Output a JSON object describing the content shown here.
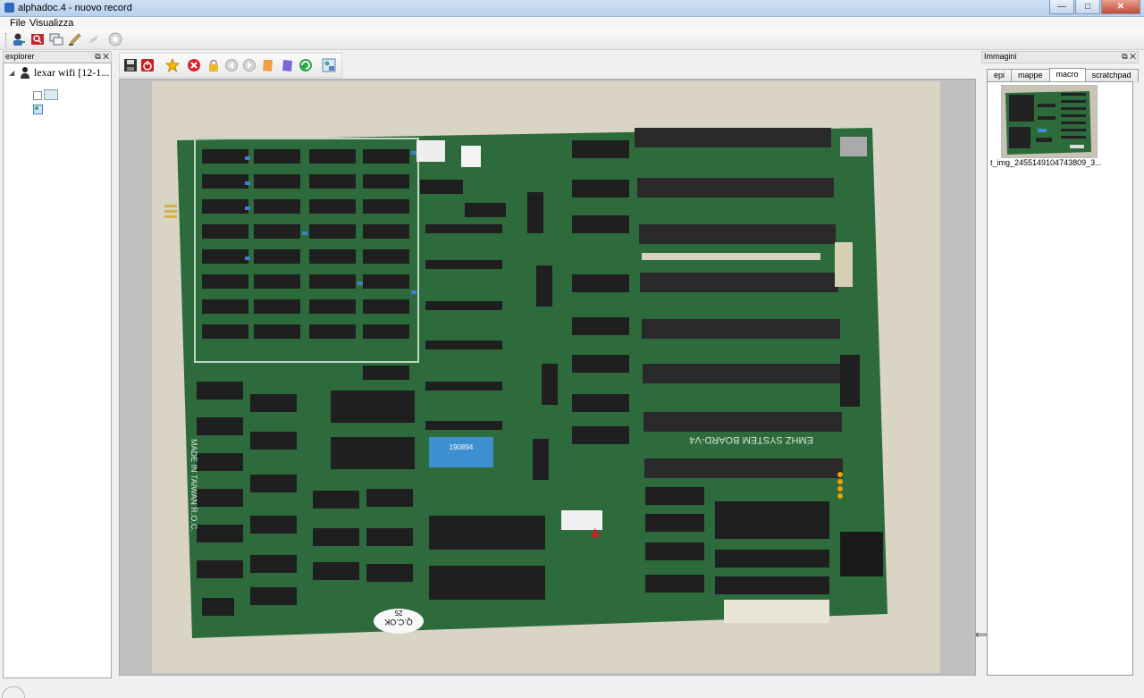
{
  "window": {
    "title": "alphadoc.4 - nuovo record",
    "btn_min": "—",
    "btn_max": "□",
    "btn_close": "✕"
  },
  "menu": {
    "items": [
      "File",
      "Visualizza"
    ]
  },
  "main_toolbar": {
    "icons": [
      "user-add-icon",
      "search-record-icon",
      "windows-icon",
      "edit-pen-icon",
      "disabled-tool-icon",
      "help-icon"
    ]
  },
  "explorer": {
    "title": "explorer",
    "float_btn": "⧉",
    "close_btn": "✕",
    "expand_arrow": "◢",
    "root_label": "lexar wifi [12-1..."
  },
  "doc_toolbar": {
    "icons": [
      "save-icon",
      "power-icon",
      "star-icon",
      "delete-icon",
      "lock-icon",
      "back-icon",
      "forward-icon",
      "note-orange-icon",
      "note-purple-icon",
      "refresh-green-icon",
      "image-settings-icon"
    ]
  },
  "images_panel": {
    "title": "Immagini",
    "float_btn": "⧉",
    "close_btn": "✕",
    "tabs": [
      "epi",
      "mappe",
      "macro",
      "scratchpad"
    ],
    "active_tab": "macro",
    "thumb_label": "t_img_2455149104743809_3..."
  },
  "board": {
    "silk_label": "EMHZ SYSTEM BOARD-V4",
    "made_in": "MADE IN TAIWAN R.O.C.",
    "qc_sticker": "Q.C.OK",
    "qc_number": "25",
    "eprom_label": "190894"
  },
  "colors": {
    "pcb": "#2d6b3c",
    "chip": "#222222",
    "slot": "#2a2a2a",
    "background_paper": "#d9d4c4"
  }
}
